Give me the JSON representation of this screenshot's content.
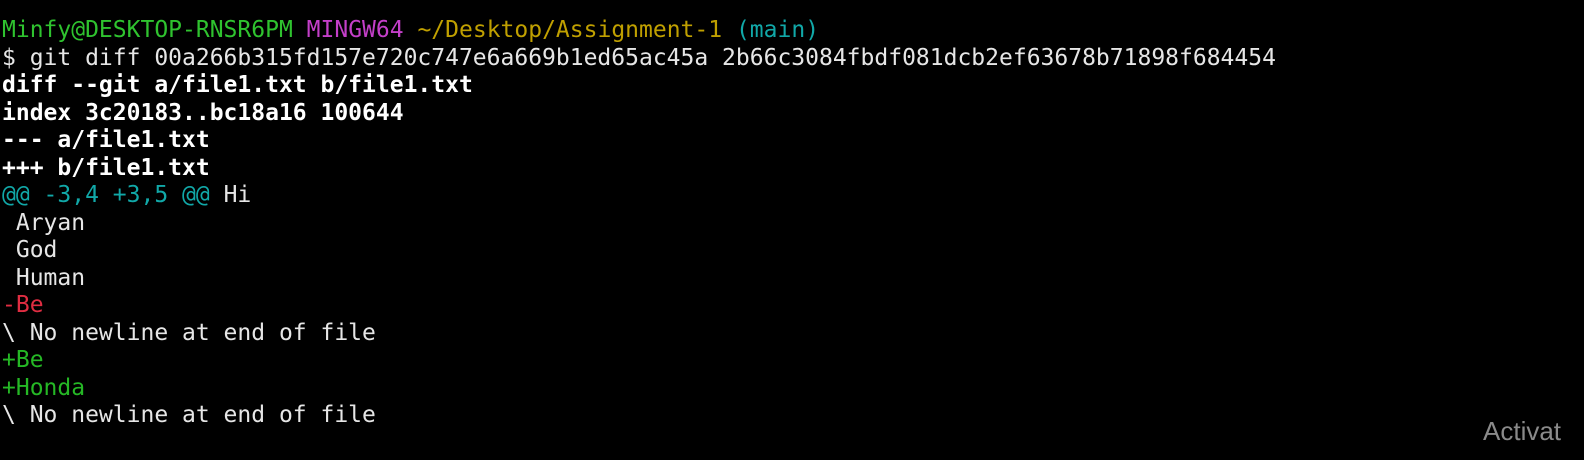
{
  "prompt": {
    "user_host": "Minfy@DESKTOP-RNSR6PM",
    "env": "MINGW64",
    "path": "~/Desktop/Assignment-1",
    "branch": "(main)"
  },
  "command": "$ git diff 00a266b315fd157e720c747e6a669b1ed65ac45a 2b66c3084fbdf081dcb2ef63678b71898f684454",
  "diff_header": {
    "git_line": "diff --git a/file1.txt b/file1.txt",
    "index_line": "index 3c20183..bc18a16 100644",
    "old_file": "--- a/file1.txt",
    "new_file": "+++ b/file1.txt"
  },
  "hunk": {
    "range": "@@ -3,4 +3,5 @@",
    "context": " Hi"
  },
  "lines": [
    " Aryan",
    " God",
    " Human",
    "-Be",
    "\\ No newline at end of file",
    "+Be",
    "+Honda",
    "\\ No newline at end of file"
  ],
  "watermark": "Activat",
  "colors": {
    "background": "#000000",
    "user": "#2fc32f",
    "env": "#c43fc9",
    "path": "#c0a000",
    "branch": "#11a8a8",
    "deleted": "#e02d42",
    "added": "#25b825"
  }
}
